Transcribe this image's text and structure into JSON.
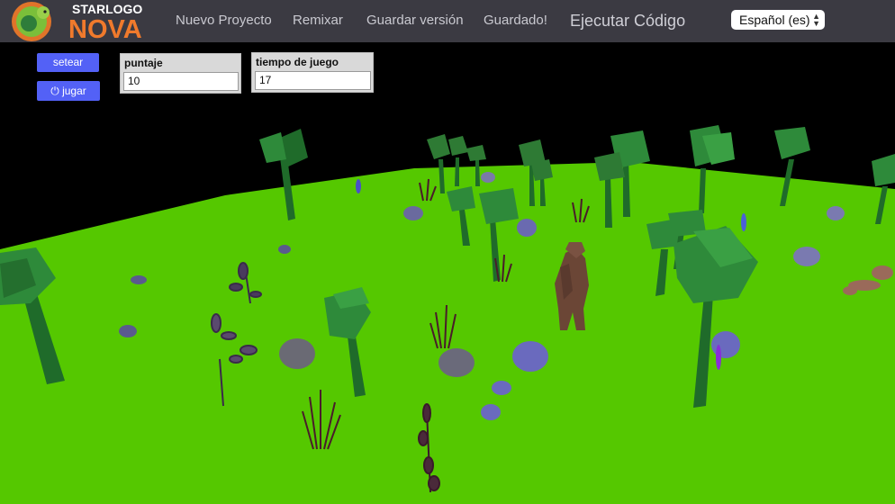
{
  "logo": {
    "line1": "STARLOGO",
    "line2": "NOVA"
  },
  "nav": {
    "new_project": "Nuevo Proyecto",
    "remix": "Remixar",
    "save_version": "Guardar versión",
    "saved": "Guardado!",
    "run_code": "Ejecutar Código",
    "language": "Español (es)"
  },
  "controls": {
    "setup_label": "setear",
    "play_label": "jugar",
    "play_icon": "power-icon"
  },
  "widgets": [
    {
      "label": "puntaje",
      "value": "10"
    },
    {
      "label": "tiempo de juego",
      "value": "17"
    }
  ],
  "colors": {
    "navbar": "#3b3a42",
    "button": "#5361f6",
    "ground": "#55c800",
    "sky": "#000000",
    "tree_canopy": "#2f8a3c",
    "tree_trunk": "#1f6b2a",
    "rock": "#6a6a9e",
    "bear": "#6b4636"
  }
}
